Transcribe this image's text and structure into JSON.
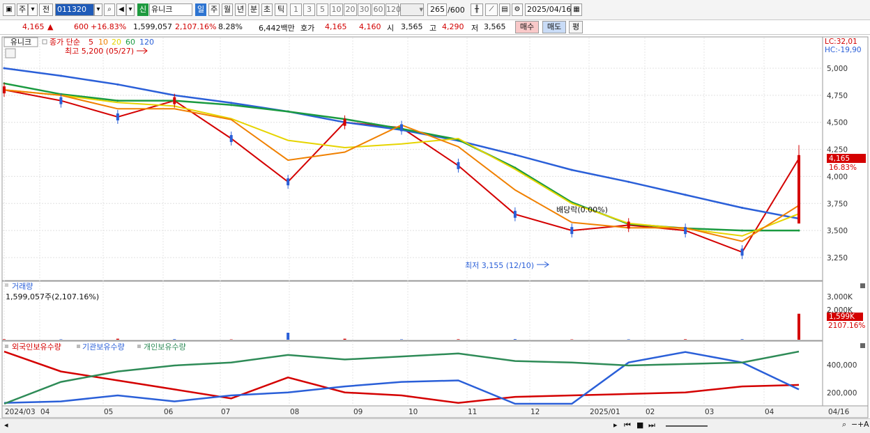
{
  "toolbar": {
    "market_1": "주",
    "market_2": "전",
    "code": "011320",
    "search_icon": "search-icon",
    "sound_icon": "speaker-icon",
    "new_badge": "신",
    "name": "유니크",
    "periods": [
      "일",
      "주",
      "월",
      "년",
      "분",
      "초",
      "틱"
    ],
    "intervals": [
      "1",
      "3",
      "5",
      "10",
      "20",
      "30",
      "60",
      "120"
    ],
    "count": "265",
    "count_total": "/600",
    "date": "2025/04/16"
  },
  "quote": {
    "price": "4,165",
    "up_symbol": "▲",
    "change": "600",
    "change_pct": "+16.83%",
    "volume": "1,599,057",
    "volume_pct": "2,107.16%",
    "turnover": "8.28%",
    "amount": "6,442백만",
    "hoga_label": "호가",
    "ask": "4,165",
    "bid": "4,160",
    "open_label": "시",
    "open": "3,565",
    "high_label": "고",
    "high": "4,290",
    "low_label": "저",
    "low": "3,565",
    "buy": "매수",
    "sell": "매도",
    "eval": "평"
  },
  "price_panel": {
    "stock": "유니크",
    "legend": "종가 단순",
    "ma": [
      {
        "label": "5",
        "color": "#d40000"
      },
      {
        "label": "10",
        "color": "#f08000"
      },
      {
        "label": "20",
        "color": "#e6d400"
      },
      {
        "label": "60",
        "color": "#1a9a40"
      },
      {
        "label": "120",
        "color": "#2a5fd8"
      }
    ],
    "lc": "LC:32,01",
    "hc": "HC:-19,90",
    "high_note": "최고 5,200 (05/27)",
    "low_note": "최저 3,155 (12/10)",
    "dividend_note": "배당락(0.00%)",
    "last_price": "4,165",
    "last_pct": "16.83%",
    "y_ticks": [
      "5,000",
      "4,750",
      "4,500",
      "4,250",
      "4,000",
      "3,750",
      "3,500",
      "3,250"
    ]
  },
  "volume_panel": {
    "title": "거래량",
    "value": "1,599,057주(2,107.16%)",
    "y_ticks": [
      "3,000K",
      "2,000K"
    ],
    "last": "1,599K",
    "last_pct": "2107.16%"
  },
  "holding_panel": {
    "series": [
      {
        "label": "외국인보유수량",
        "color": "#d40000"
      },
      {
        "label": "기관보유수량",
        "color": "#2a5fd8"
      },
      {
        "label": "개인보유수량",
        "color": "#2e8b57"
      }
    ],
    "y_ticks": [
      "400,000",
      "200,000"
    ]
  },
  "x_axis": [
    "2024/03",
    "04",
    "05",
    "06",
    "07",
    "08",
    "09",
    "10",
    "11",
    "12",
    "2025/01",
    "02",
    "03",
    "04"
  ],
  "x_axis_right": "04/16",
  "chart_data": {
    "type": "line",
    "title": "유니크",
    "x": [
      "2024/03",
      "04",
      "05",
      "06",
      "07",
      "08",
      "09",
      "10",
      "11",
      "12",
      "2025/01",
      "02",
      "03",
      "04",
      "04/16"
    ],
    "series": [
      {
        "name": "종가",
        "values": [
          4800,
          4700,
          4550,
          4700,
          4350,
          3950,
          4500,
          4450,
          4100,
          3650,
          3500,
          3550,
          3500,
          3300,
          4165
        ]
      },
      {
        "name": "120",
        "values": [
          5000,
          4930,
          4850,
          4750,
          4680,
          4600,
          4500,
          4430,
          4330,
          4200,
          4060,
          3950,
          3830,
          3710,
          3610
        ]
      },
      {
        "name": "60",
        "values": [
          4860,
          4760,
          4700,
          4700,
          4660,
          4600,
          4530,
          4440,
          4340,
          4080,
          3760,
          3560,
          3520,
          3500,
          3500
        ]
      },
      {
        "name": "외국인보유수량",
        "values": [
          520000,
          360000,
          300000,
          240000,
          180000,
          320000,
          220000,
          200000,
          150000,
          190000,
          200000,
          210000,
          220000,
          260000,
          270000
        ]
      },
      {
        "name": "기관보유수량",
        "values": [
          150000,
          160000,
          200000,
          160000,
          200000,
          220000,
          260000,
          290000,
          300000,
          140000,
          140000,
          420000,
          490000,
          420000,
          240000
        ]
      },
      {
        "name": "개인보유수량",
        "values": [
          140000,
          290000,
          360000,
          400000,
          420000,
          470000,
          440000,
          460000,
          480000,
          430000,
          420000,
          400000,
          410000,
          420000,
          500000
        ]
      }
    ],
    "ylim": [
      3150,
      5250
    ],
    "high": {
      "value": 5200,
      "date": "05/27"
    },
    "low": {
      "value": 3155,
      "date": "12/10"
    },
    "last": 4165
  }
}
